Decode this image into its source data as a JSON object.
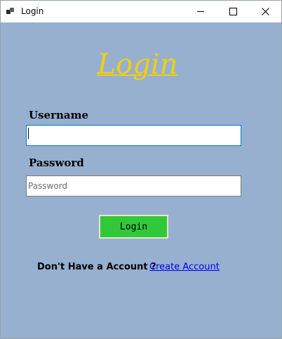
{
  "window": {
    "title": "Login",
    "app_icon": "app-window-icon",
    "controls": {
      "minimize_icon": "minimize-icon",
      "maximize_icon": "maximize-icon",
      "close_icon": "close-icon",
      "close_glyph": "✕"
    }
  },
  "form": {
    "heading": "Login",
    "username_label": "Username",
    "username_value": "",
    "password_label": "Password",
    "password_placeholder": "Password",
    "login_button": "Login"
  },
  "footer": {
    "prompt": "Don't Have a Account ?",
    "create_account_link": "Create Account"
  },
  "colors": {
    "background": "#97b0d0",
    "heading": "#f2cf10",
    "login_button": "#31c93a",
    "link": "#0000ee"
  }
}
